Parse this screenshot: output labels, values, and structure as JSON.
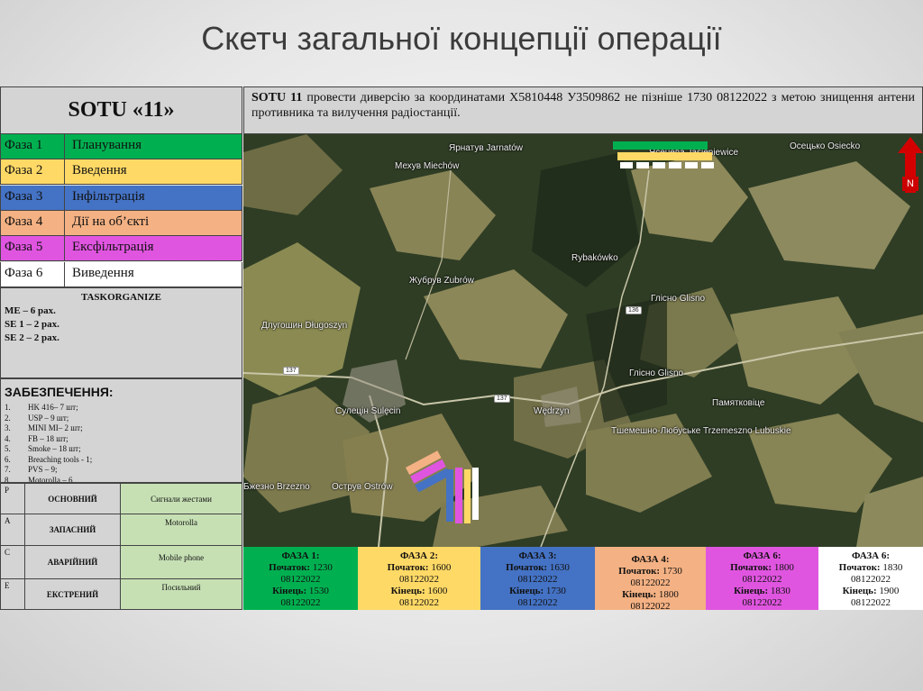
{
  "title": "Скетч загальної концепції операції",
  "left": {
    "sotu": "SOTU «11»",
    "phases": [
      {
        "num": "Фаза 1",
        "name": "Планування",
        "color": "#00b050"
      },
      {
        "num": "Фаза 2",
        "name": "Введення",
        "color": "#ffd966"
      },
      {
        "num": "Фаза 3",
        "name": "Інфільтрація",
        "color": "#4472c4"
      },
      {
        "num": "Фаза 4",
        "name": "Дії на об’єкті",
        "color": "#f4b183"
      },
      {
        "num": "Фаза 5",
        "name": "Ексфільтрація",
        "color": "#e055e0"
      },
      {
        "num": "Фаза 6",
        "name": "Виведення",
        "color": "#ffffff"
      }
    ],
    "task": {
      "title": "TASKORGANIZE",
      "lines": [
        "ME – 6 рах.",
        "SE 1 – 2 рах.",
        "SE 2 – 2 рах."
      ]
    },
    "supply": {
      "title": "ЗАБЕЗПЕЧЕННЯ:",
      "items": [
        {
          "n": "1.",
          "t": "HK 416– 7 шт;"
        },
        {
          "n": "2.",
          "t": "USP – 9 шт;"
        },
        {
          "n": "3.",
          "t": "MINI MI– 2 шт;"
        },
        {
          "n": "4.",
          "t": "FB – 18 шт;"
        },
        {
          "n": "5.",
          "t": "Smoke  – 18 шт;"
        },
        {
          "n": "6.",
          "t": "Breaching tools - 1;"
        },
        {
          "n": "7.",
          "t": "PVS – 9;"
        },
        {
          "n": "8.",
          "t": "Motorolla – 6"
        }
      ]
    },
    "pace": [
      {
        "letter": "P",
        "mode": "ОСНОВНИЙ",
        "means": "Сигнали жестами"
      },
      {
        "letter": "A",
        "mode": "ЗАПАСНИЙ",
        "means": "Motorolla"
      },
      {
        "letter": "C",
        "mode": "АВАРІЙНИЙ",
        "means": "Mobile phone"
      },
      {
        "letter": "E",
        "mode": "ЕКСТРЕНИЙ",
        "means": "Посильний"
      }
    ]
  },
  "mission": {
    "lead": "SOTU 11",
    "text": " провести диверсію за координатами X5810448 У3509862 не пізніше 1730 08122022 з метою знищення антени противника та вилучення радіостанції."
  },
  "map": {
    "labels": [
      "Ярнатув Jarnatów",
      "Ясенева Jasieniewice",
      "Осецько Osiecko",
      "Мехув Miechów",
      "Rybakówko",
      "Жубрув Zubrów",
      "Глісно Glisno",
      "Глісно Glisno",
      "Длугошин Długoszyn",
      "Памятковіце",
      "Сулецін Sulęcin",
      "Wędrzyn",
      "Тшемешно-Любуське Trzemeszno Lubuskie",
      "Бжезно Brzezno",
      "Острув Ostrów"
    ],
    "road_numbers": [
      "136",
      "137",
      "137"
    ],
    "north": "N"
  },
  "phase_boxes": [
    {
      "title": "ФАЗА 1:",
      "start_lbl": "Початок:",
      "start": "1230",
      "start_date": "08122022",
      "end_lbl": "Кінець:",
      "end": "1530",
      "end_date": "08122022",
      "bg": "#00b050"
    },
    {
      "title": "ФАЗА 2:",
      "start_lbl": "Початок:",
      "start": "1600",
      "start_date": "08122022",
      "end_lbl": "Кінець:",
      "end": "1600",
      "end_date": "08122022",
      "bg": "#ffd966"
    },
    {
      "title": "ФАЗА 3:",
      "start_lbl": "Початок:",
      "start": "1630",
      "start_date": "08122022",
      "end_lbl": "Кінець:",
      "end": "1730",
      "end_date": "08122022",
      "bg": "#4472c4"
    },
    {
      "title": "ФАЗА 4:",
      "start_lbl": "Початок:",
      "start": "1730",
      "start_date": "08122022",
      "end_lbl": "Кінець:",
      "end": "1800",
      "end_date": "08122022",
      "bg": "#f4b183"
    },
    {
      "title": "ФАЗА 6:",
      "start_lbl": "Початок:",
      "start": "1800",
      "start_date": "08122022",
      "end_lbl": "Кінець:",
      "end": "1830",
      "end_date": "08122022",
      "bg": "#e055e0"
    },
    {
      "title": "ФАЗА 6:",
      "start_lbl": "Початок:",
      "start": "1830",
      "start_date": "08122022",
      "end_lbl": "Кінець:",
      "end": "1900",
      "end_date": "08122022",
      "bg": "#ffffff"
    }
  ]
}
